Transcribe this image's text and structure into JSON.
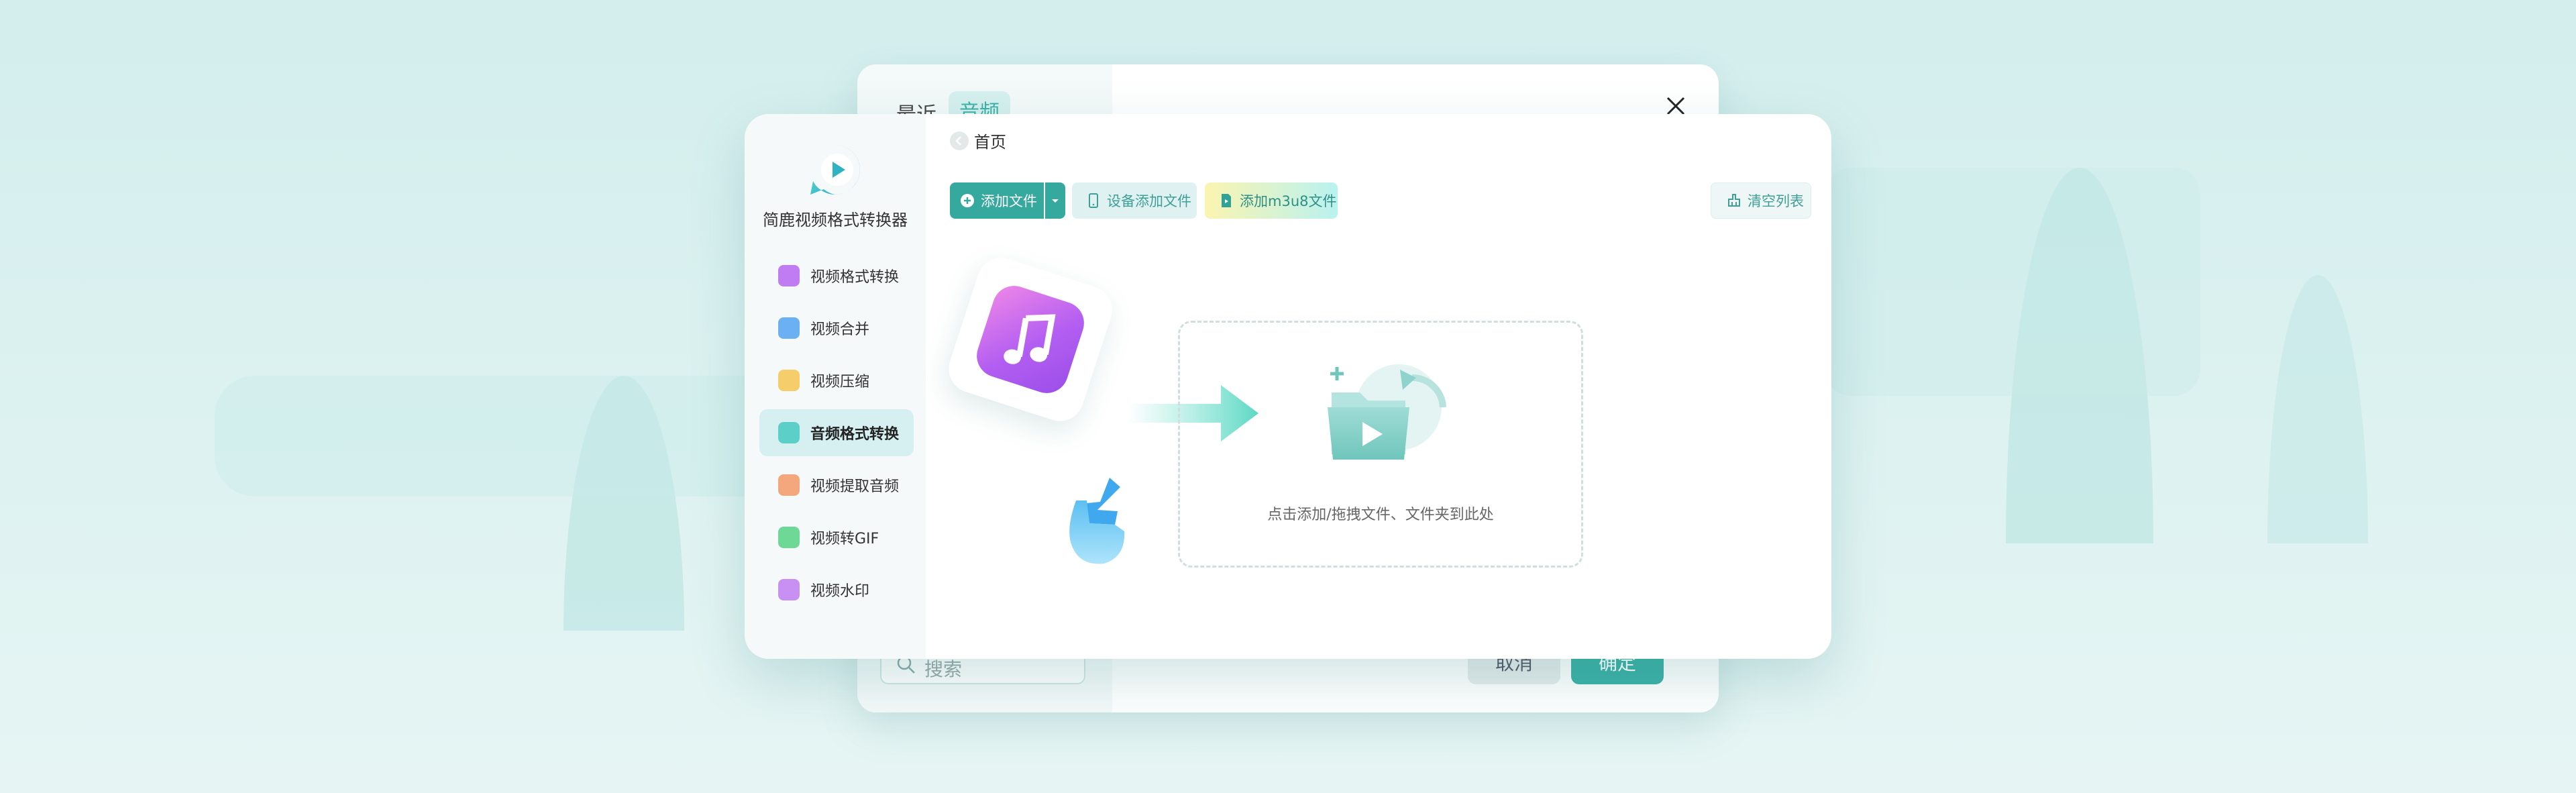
{
  "back_window": {
    "tabs": [
      "最近",
      "音频"
    ],
    "search_placeholder": "搜索",
    "cancel_label": "取消",
    "confirm_label": "确定"
  },
  "app": {
    "name": "简鹿视频格式转换器"
  },
  "sidebar": {
    "items": [
      {
        "label": "视频格式转换",
        "icon": "video-convert-icon",
        "color": "#b466f0",
        "active": false
      },
      {
        "label": "视频合并",
        "icon": "video-merge-icon",
        "color": "#5aa7f0",
        "active": false
      },
      {
        "label": "视频压缩",
        "icon": "video-compress-icon",
        "color": "#f4c65a",
        "active": false
      },
      {
        "label": "音频格式转换",
        "icon": "audio-convert-icon",
        "color": "#4cc6c0",
        "active": true
      },
      {
        "label": "视频提取音频",
        "icon": "extract-audio-icon",
        "color": "#f29a6a",
        "active": false
      },
      {
        "label": "视频转GIF",
        "icon": "gif-icon",
        "color": "#5fd08a",
        "active": false
      },
      {
        "label": "视频水印",
        "icon": "watermark-icon",
        "color": "#c084f0",
        "active": false
      }
    ]
  },
  "breadcrumb": {
    "label": "首页"
  },
  "toolbar": {
    "add_file": "添加文件",
    "device_add": "设备添加文件",
    "add_m3u8": "添加m3u8文件",
    "clear_list": "清空列表"
  },
  "drop_zone": {
    "hint": "点击添加/拖拽文件、文件夹到此处"
  },
  "colors": {
    "accent": "#36a99f",
    "background": "#d3eeed",
    "active_nav": "#d6eff0"
  }
}
